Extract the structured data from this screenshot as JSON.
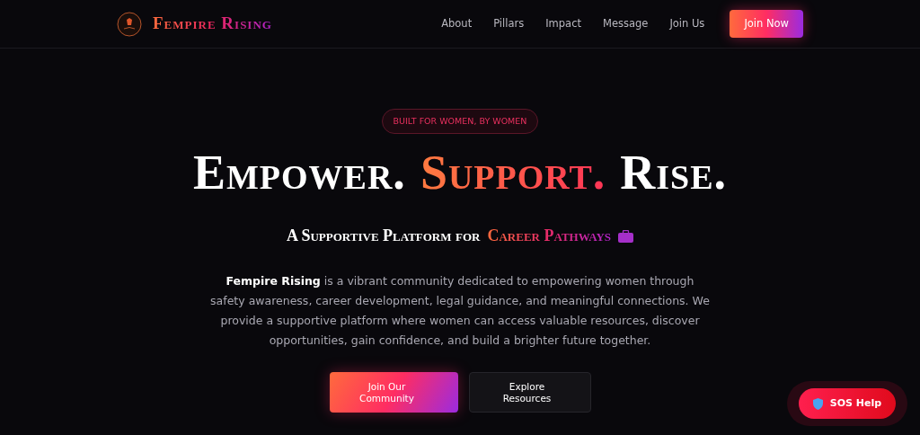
{
  "brand": "Fempire Rising",
  "nav": [
    {
      "label": "About"
    },
    {
      "label": "Pillars"
    },
    {
      "label": "Impact"
    },
    {
      "label": "Message"
    },
    {
      "label": "Join Us"
    }
  ],
  "nav_cta": "Join Now",
  "badge": "BUILT FOR WOMEN, BY WOMEN",
  "headline": [
    {
      "text": "Empower.",
      "kind": "plain"
    },
    {
      "text": "Support.",
      "kind": "accent"
    },
    {
      "text": "Rise.",
      "kind": "plain"
    }
  ],
  "subtitle": [
    {
      "text": "A Supportive Platform for",
      "kind": "plain"
    },
    {
      "text": "Career Pathways",
      "kind": "accent"
    }
  ],
  "description": "**Fempire Rising** is a vibrant community dedicated to empowering women through safety awareness, career development, legal guidance, and meaningful connections. We provide a supportive platform where women can access valuable resources, discover opportunities, gain confidence, and build a brighter future together.",
  "buttons": [
    {
      "label": "Join Our Community",
      "kind": "primary"
    },
    {
      "label": "Explore Resources",
      "kind": "secondary"
    }
  ],
  "sos": "SOS Help"
}
